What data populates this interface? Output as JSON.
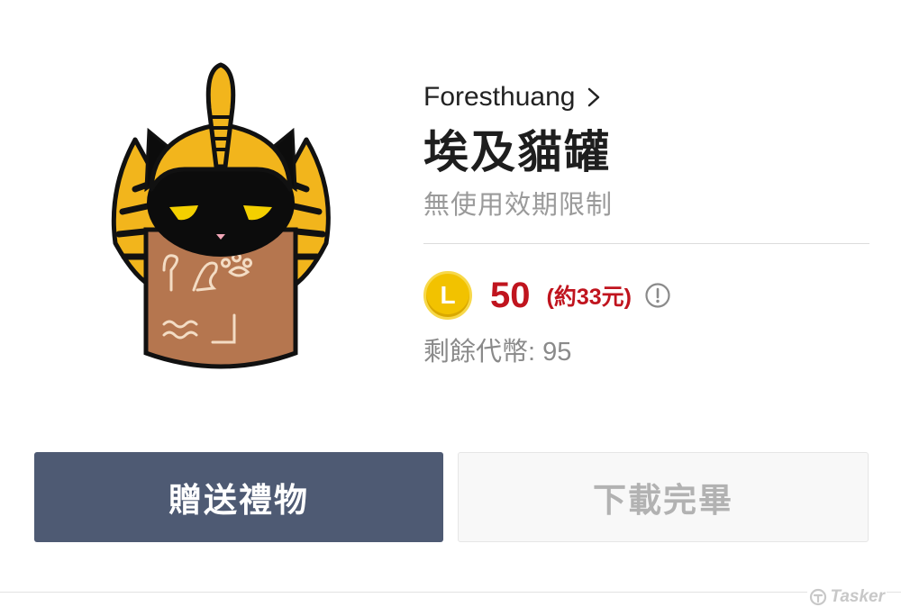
{
  "sticker": {
    "icon": "pharaoh-cat-sticker"
  },
  "author": {
    "name": "Foresthuang",
    "icon": "chevron-right-icon"
  },
  "title": "埃及貓罐",
  "validity": "無使用效期限制",
  "price": {
    "coin_icon": "line-coin-icon",
    "coin_letter": "L",
    "amount": "50",
    "approx": "(約33元)",
    "info_icon": "info-circle-icon",
    "color": "#c0141e"
  },
  "remaining": "剩餘代幣: 95",
  "buttons": {
    "gift_label": "贈送禮物",
    "done_label": "下載完畢",
    "gift_color": "#4e5a73"
  },
  "watermark": "Tasker"
}
